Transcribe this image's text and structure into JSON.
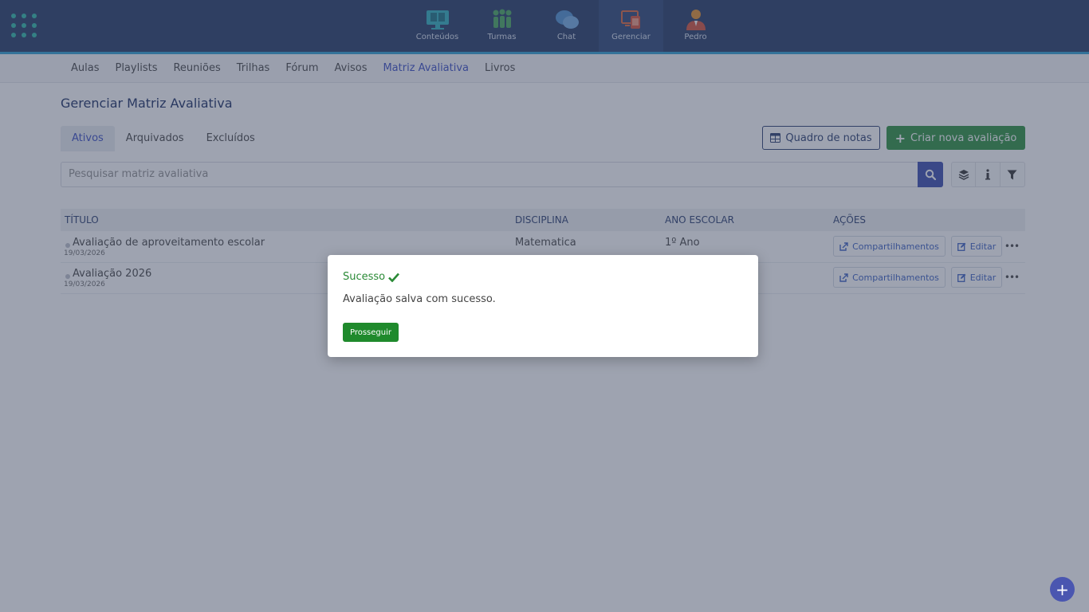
{
  "topnav": {
    "items": [
      {
        "label": "Conteúdos",
        "icon": "monitor-book-icon"
      },
      {
        "label": "Turmas",
        "icon": "people-group-icon"
      },
      {
        "label": "Chat",
        "icon": "chat-bubbles-icon"
      },
      {
        "label": "Gerenciar",
        "icon": "manage-devices-icon"
      },
      {
        "label": "Pedro",
        "icon": "user-avatar-icon"
      }
    ],
    "active": "Gerenciar"
  },
  "subnav": {
    "items": [
      "Aulas",
      "Playlists",
      "Reuniões",
      "Trilhas",
      "Fórum",
      "Avisos",
      "Matriz Avaliativa",
      "Livros"
    ],
    "active": "Matriz Avaliativa"
  },
  "page": {
    "title": "Gerenciar Matriz Avaliativa"
  },
  "tabs": {
    "items": [
      "Ativos",
      "Arquivados",
      "Excluídos"
    ],
    "active": "Ativos"
  },
  "toolbar": {
    "notes_label": "Quadro de notas",
    "create_label": "Criar nova avaliação"
  },
  "search": {
    "placeholder": "Pesquisar matriz avaliativa"
  },
  "table": {
    "headers": [
      "TÍTULO",
      "DISCIPLINA",
      "ANO ESCOLAR",
      "AÇÕES"
    ],
    "rows": [
      {
        "title": "Avaliação de aproveitamento escolar",
        "date": "19/03/2026",
        "discipline": "Matematica",
        "year": "1º Ano"
      },
      {
        "title": "Avaliação 2026",
        "date": "19/03/2026",
        "discipline": "",
        "year": ""
      }
    ],
    "share_label": "Compartilhamentos",
    "edit_label": "Editar",
    "more_label": "•••"
  },
  "modal": {
    "title": "Sucesso",
    "message": "Avaliação salva com sucesso.",
    "button": "Prosseguir"
  },
  "colors": {
    "navbar": "#354a72",
    "accent": "#4a5cc8",
    "success": "#1f8a2c"
  }
}
